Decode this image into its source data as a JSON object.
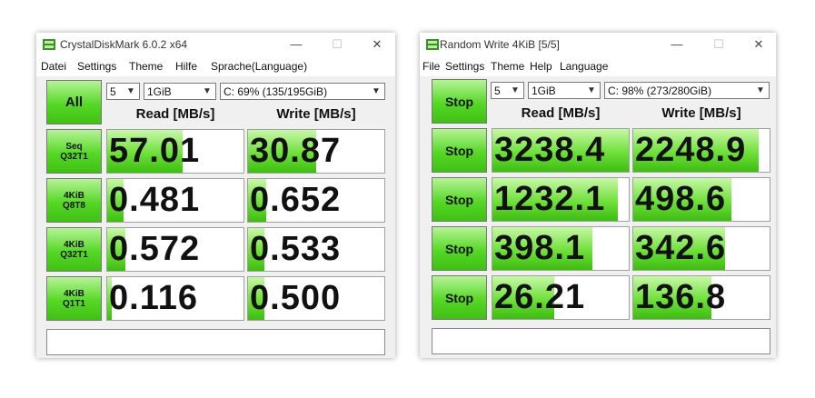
{
  "accent_green": "#56d826",
  "windows": [
    {
      "title": "CrystalDiskMark 6.0.2 x64",
      "menu": [
        "Datei",
        "Settings",
        "Theme",
        "Hilfe",
        "Sprache(Language)"
      ],
      "main_button": "All",
      "count": "5",
      "size": "1GiB",
      "drive": "C: 69% (135/195GiB)",
      "read_header": "Read [MB/s]",
      "write_header": "Write [MB/s]",
      "rows": [
        {
          "label1": "Seq",
          "label2": "Q32T1",
          "read": "57.01",
          "write": "30.87",
          "read_fill": 0.55,
          "write_fill": 0.5
        },
        {
          "label1": "4KiB",
          "label2": "Q8T8",
          "read": "0.481",
          "write": "0.652",
          "read_fill": 0.12,
          "write_fill": 0.13
        },
        {
          "label1": "4KiB",
          "label2": "Q32T1",
          "read": "0.572",
          "write": "0.533",
          "read_fill": 0.13,
          "write_fill": 0.12
        },
        {
          "label1": "4KiB",
          "label2": "Q1T1",
          "read": "0.116",
          "write": "0.500",
          "read_fill": 0.03,
          "write_fill": 0.12
        }
      ]
    },
    {
      "title": "Random Write 4KiB [5/5]",
      "menu": [
        "File",
        "Settings",
        "Theme",
        "Help",
        "Language"
      ],
      "main_button": "Stop",
      "count": "5",
      "size": "1GiB",
      "drive": "C: 98% (273/280GiB)",
      "read_header": "Read [MB/s]",
      "write_header": "Write [MB/s]",
      "rows": [
        {
          "label1": "Stop",
          "label2": "",
          "read": "3238.4",
          "write": "2248.9",
          "read_fill": 1.0,
          "write_fill": 0.92
        },
        {
          "label1": "Stop",
          "label2": "",
          "read": "1232.1",
          "write": "498.6",
          "read_fill": 0.92,
          "write_fill": 0.72
        },
        {
          "label1": "Stop",
          "label2": "",
          "read": "398.1",
          "write": "342.6",
          "read_fill": 0.73,
          "write_fill": 0.67
        },
        {
          "label1": "Stop",
          "label2": "",
          "read": "26.21",
          "write": "136.8",
          "read_fill": 0.45,
          "write_fill": 0.57
        }
      ]
    }
  ]
}
